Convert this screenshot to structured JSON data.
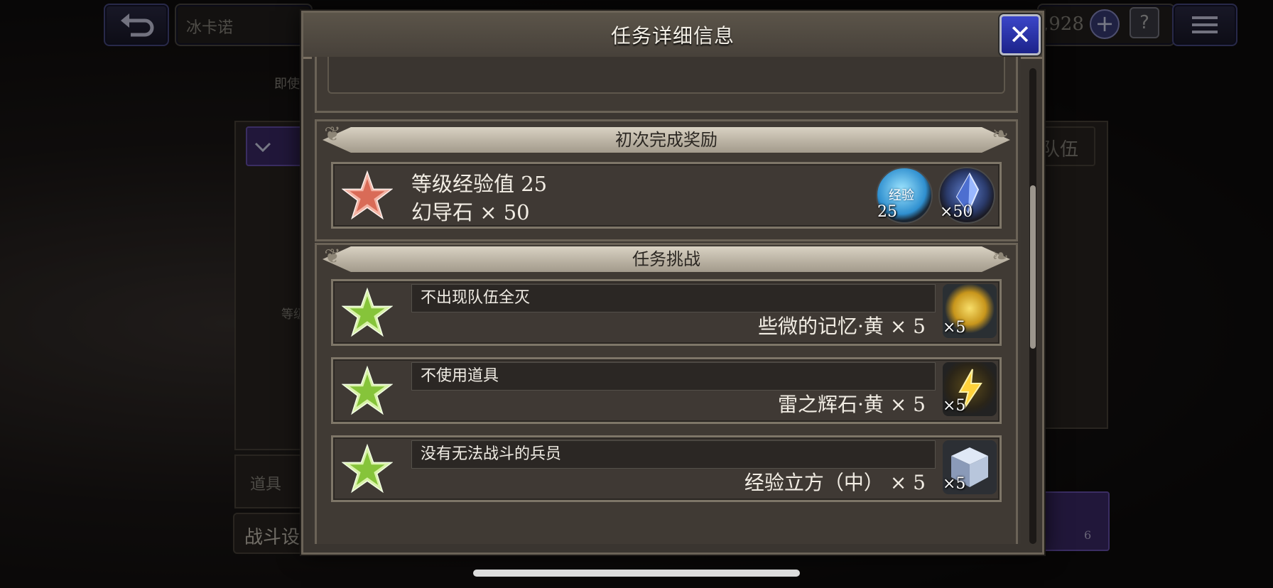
{
  "background": {
    "player_name": "冰卡诺",
    "currency_partial": ",928",
    "partial_text_1": "即使",
    "partial_text_2": "队伍",
    "partial_text_3": "等级",
    "item_tab": "道具",
    "battle_setting_partial": "战斗设",
    "page_number": "6"
  },
  "modal": {
    "title": "任务详细信息",
    "first_clear": {
      "heading": "初次完成奖励",
      "line1": "等级经验值 25",
      "line2": "幻导石 × 50",
      "icons": [
        {
          "name": "exp-icon",
          "label": "经验",
          "count": "25"
        },
        {
          "name": "lapis-icon",
          "count": "×50"
        }
      ]
    },
    "challenges": {
      "heading": "任务挑战",
      "items": [
        {
          "condition": "不出现队伍全灭",
          "reward": "些微的记忆·黄 × 5",
          "count": "×5",
          "icon": "memory-yellow-icon"
        },
        {
          "condition": "不使用道具",
          "reward": "雷之辉石·黄 × 5",
          "count": "×5",
          "icon": "thunder-crystal-icon"
        },
        {
          "condition": "没有无法战斗的兵员",
          "reward": "经验立方（中） × 5",
          "count": "×5",
          "icon": "exp-cube-icon"
        }
      ]
    }
  },
  "colors": {
    "close_button": "#2430b0",
    "star_red": "#e58775",
    "star_green": "#9fd35a"
  }
}
